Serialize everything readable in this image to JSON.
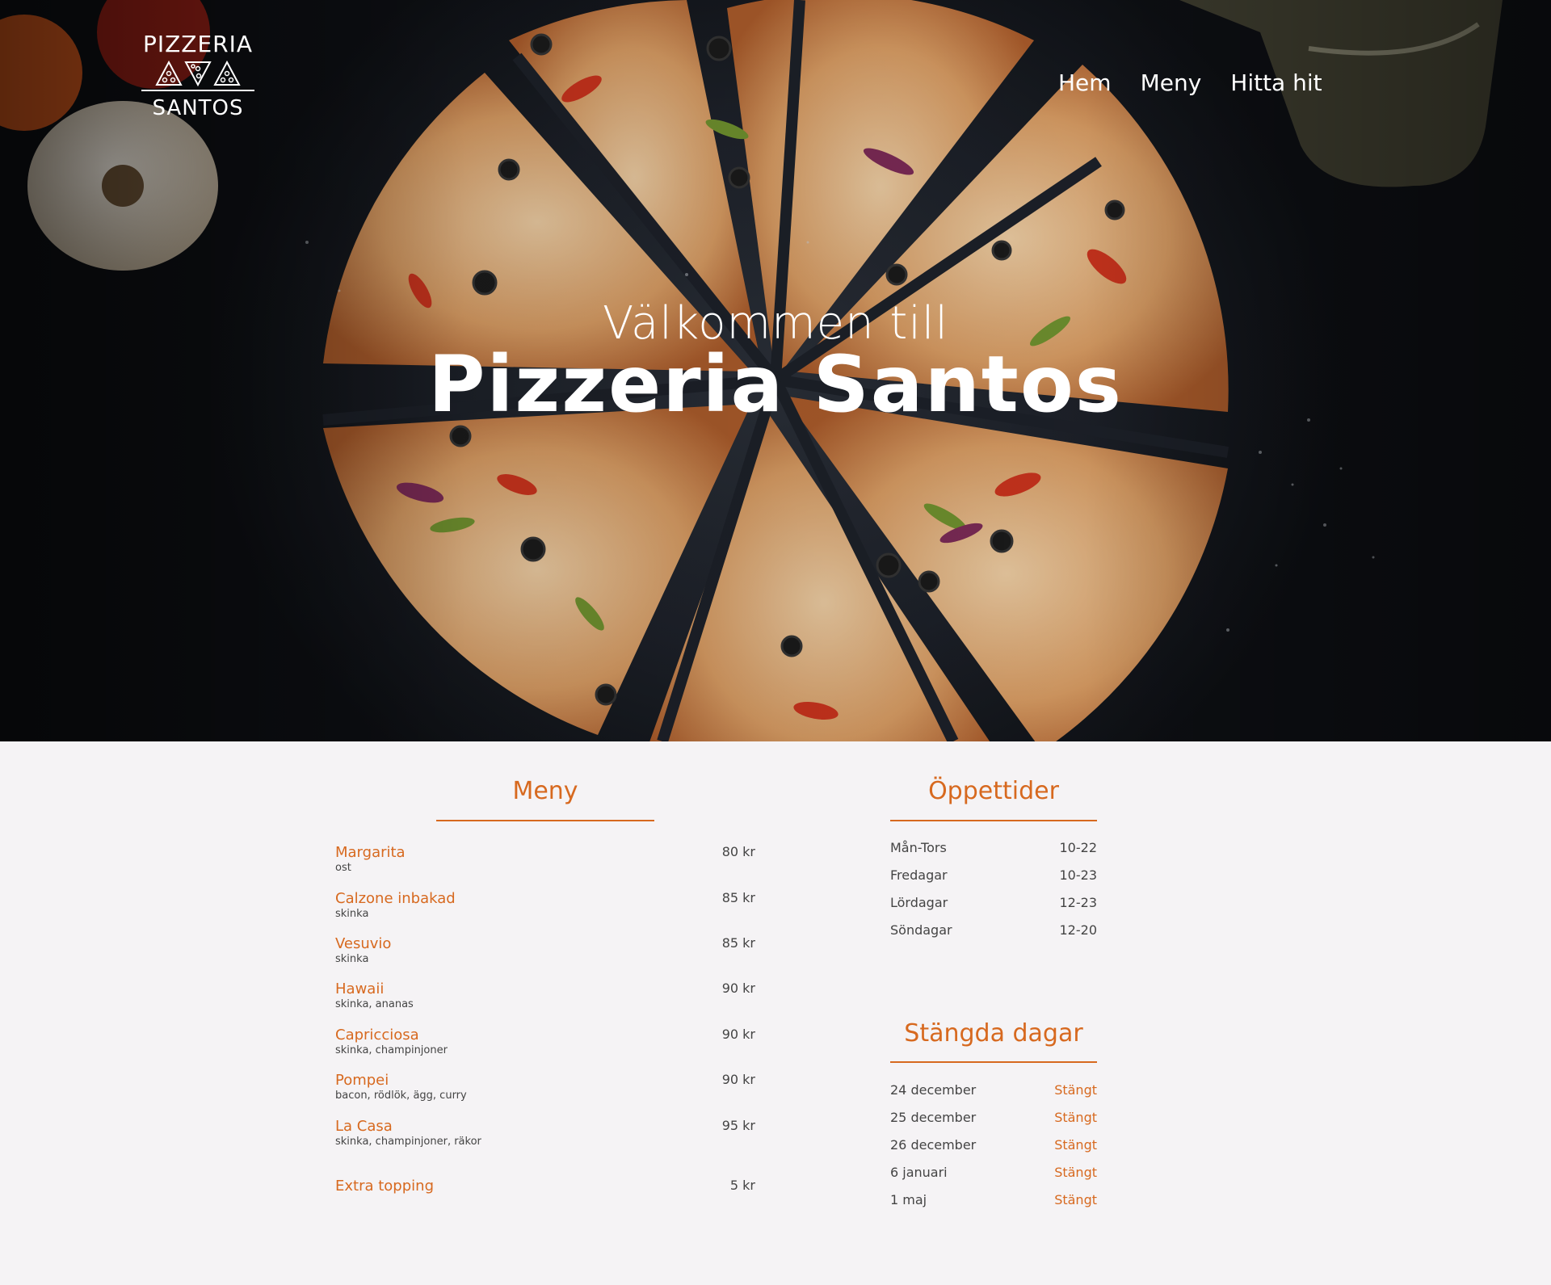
{
  "brand": {
    "line1": "PIZZERIA",
    "line2": "SANTOS"
  },
  "nav": {
    "items": [
      "Hem",
      "Meny",
      "Hitta hit"
    ]
  },
  "hero": {
    "welcome": "Välkommen till",
    "name": "Pizzeria Santos"
  },
  "menu": {
    "title": "Meny",
    "items": [
      {
        "name": "Margarita",
        "desc": "ost",
        "price": "80 kr"
      },
      {
        "name": "Calzone inbakad",
        "desc": "skinka",
        "price": "85 kr"
      },
      {
        "name": "Vesuvio",
        "desc": "skinka",
        "price": "85 kr"
      },
      {
        "name": "Hawaii",
        "desc": "skinka, ananas",
        "price": "90 kr"
      },
      {
        "name": "Capricciosa",
        "desc": "skinka, champinjoner",
        "price": "90 kr"
      },
      {
        "name": "Pompei",
        "desc": "bacon, rödlök, ägg, curry",
        "price": "90 kr"
      },
      {
        "name": "La Casa",
        "desc": "skinka, champinjoner, räkor",
        "price": "95 kr"
      }
    ],
    "extra": {
      "name": "Extra topping",
      "price": "5 kr"
    }
  },
  "hours": {
    "title": "Öppettider",
    "rows": [
      {
        "day": "Mån-Tors",
        "time": "10-22"
      },
      {
        "day": "Fredagar",
        "time": "10-23"
      },
      {
        "day": "Lördagar",
        "time": "12-23"
      },
      {
        "day": "Söndagar",
        "time": "12-20"
      }
    ]
  },
  "closed": {
    "title": "Stängda dagar",
    "rows": [
      {
        "date": "24 december",
        "status": "Stängt"
      },
      {
        "date": "25 december",
        "status": "Stängt"
      },
      {
        "date": "26 december",
        "status": "Stängt"
      },
      {
        "date": "6 januari",
        "status": "Stängt"
      },
      {
        "date": "1 maj",
        "status": "Stängt"
      }
    ]
  },
  "colors": {
    "accent": "#d7691f",
    "background": "#f5f3f5",
    "hero_dark": "#1c2028"
  },
  "icons": [
    "pizza-slice-icon",
    "pizza-slice-icon",
    "pizza-slice-icon"
  ]
}
